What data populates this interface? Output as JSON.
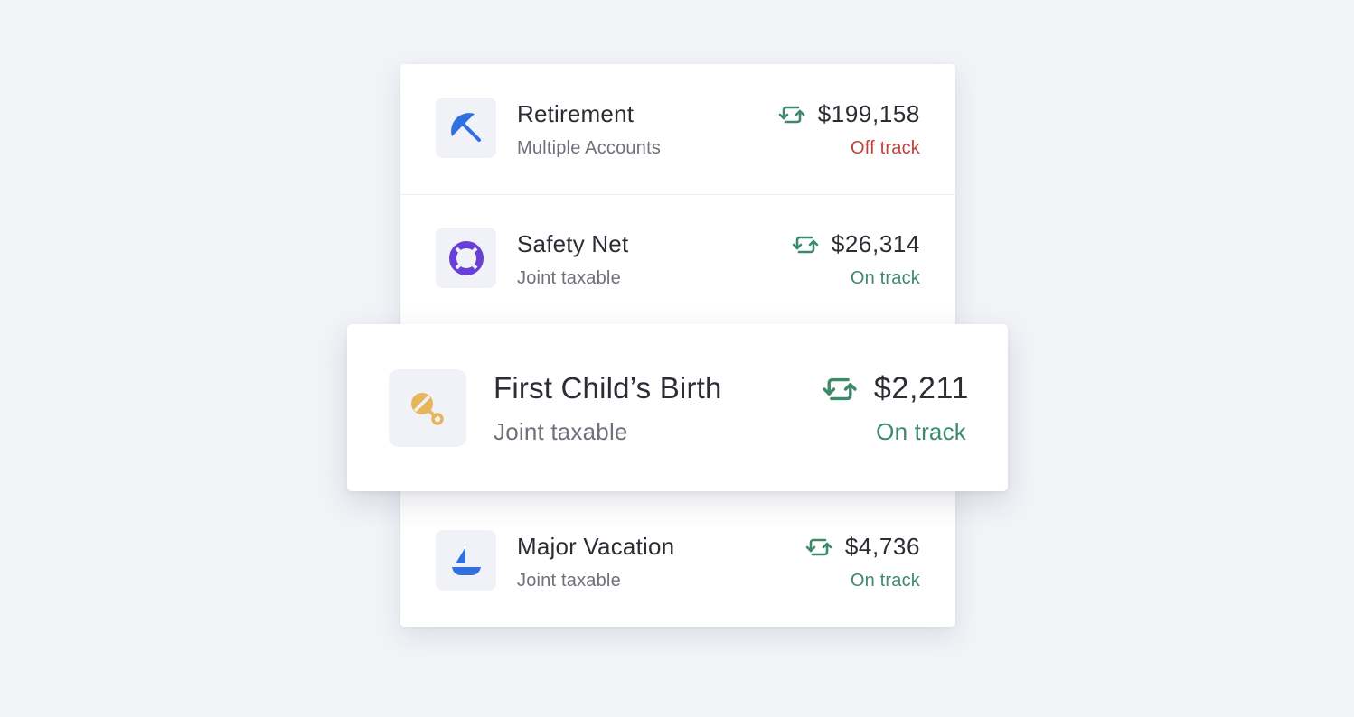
{
  "colors": {
    "on_track": "#3d8a6b",
    "off_track": "#c0423b",
    "sync_icon": "#3d8a6b"
  },
  "goals": [
    {
      "title": "Retirement",
      "subtitle": "Multiple Accounts",
      "amount": "$199,158",
      "status": "Off track",
      "icon": "umbrella-icon"
    },
    {
      "title": "Safety Net",
      "subtitle": "Joint taxable",
      "amount": "$26,314",
      "status": "On track",
      "icon": "life-ring-icon"
    },
    {
      "title": "First Child’s Birth",
      "subtitle": "Joint taxable",
      "amount": "$2,211",
      "status": "On track",
      "icon": "baby-rattle-icon"
    },
    {
      "title": "Major Vacation",
      "subtitle": "Joint taxable",
      "amount": "$4,736",
      "status": "On track",
      "icon": "sailboat-icon"
    }
  ]
}
